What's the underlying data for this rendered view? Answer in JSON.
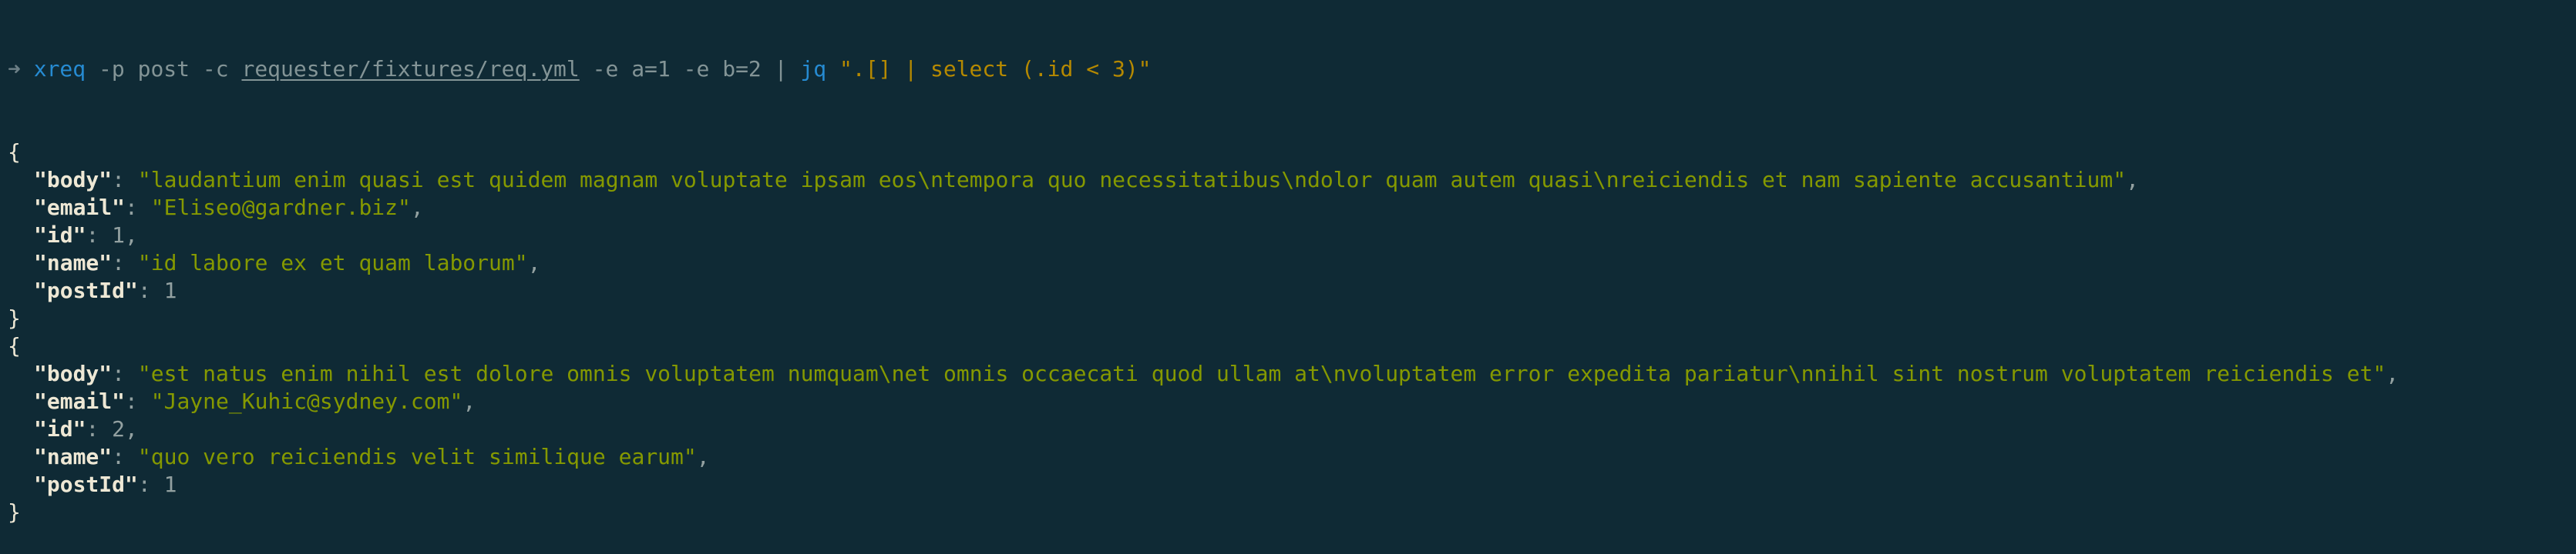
{
  "prompt": {
    "arrow": "➜",
    "command": "xreq",
    "args": [
      {
        "text": "-p",
        "kind": "flag"
      },
      {
        "text": "post",
        "kind": "arg"
      },
      {
        "text": "-c",
        "kind": "flag"
      },
      {
        "text": "requester/fixtures/req.yml",
        "kind": "path"
      },
      {
        "text": "-e",
        "kind": "flag"
      },
      {
        "text": "a=1",
        "kind": "arg"
      },
      {
        "text": "-e",
        "kind": "flag"
      },
      {
        "text": "b=2",
        "kind": "arg"
      }
    ],
    "pipe": "|",
    "jq_command": "jq",
    "jq_filter": "\".[] | select (.id < 3)\""
  },
  "output": {
    "records": [
      {
        "fields": [
          {
            "key": "\"body\"",
            "value": "\"laudantium enim quasi est quidem magnam voluptate ipsam eos\\ntempora quo necessitatibus\\ndolor quam autem quasi\\nreiciendis et nam sapiente accusantium\"",
            "type": "string",
            "trail": ","
          },
          {
            "key": "\"email\"",
            "value": "\"Eliseo@gardner.biz\"",
            "type": "string",
            "trail": ","
          },
          {
            "key": "\"id\"",
            "value": "1",
            "type": "number",
            "trail": ","
          },
          {
            "key": "\"name\"",
            "value": "\"id labore ex et quam laborum\"",
            "type": "string",
            "trail": ","
          },
          {
            "key": "\"postId\"",
            "value": "1",
            "type": "number",
            "trail": ""
          }
        ]
      },
      {
        "fields": [
          {
            "key": "\"body\"",
            "value": "\"est natus enim nihil est dolore omnis voluptatem numquam\\net omnis occaecati quod ullam at\\nvoluptatem error expedita pariatur\\nnihil sint nostrum voluptatem reiciendis et\"",
            "type": "string",
            "trail": ","
          },
          {
            "key": "\"email\"",
            "value": "\"Jayne_Kuhic@sydney.com\"",
            "type": "string",
            "trail": ","
          },
          {
            "key": "\"id\"",
            "value": "2",
            "type": "number",
            "trail": ","
          },
          {
            "key": "\"name\"",
            "value": "\"quo vero reiciendis velit similique earum\"",
            "type": "string",
            "trail": ","
          },
          {
            "key": "\"postId\"",
            "value": "1",
            "type": "number",
            "trail": ""
          }
        ]
      }
    ],
    "open_brace": "{",
    "close_brace": "}",
    "colon": ":"
  },
  "colors": {
    "background": "#0f2a35",
    "command": "#268bd2",
    "string": "#859900",
    "quoted_filter": "#b58900",
    "key": "#eee8d5"
  }
}
